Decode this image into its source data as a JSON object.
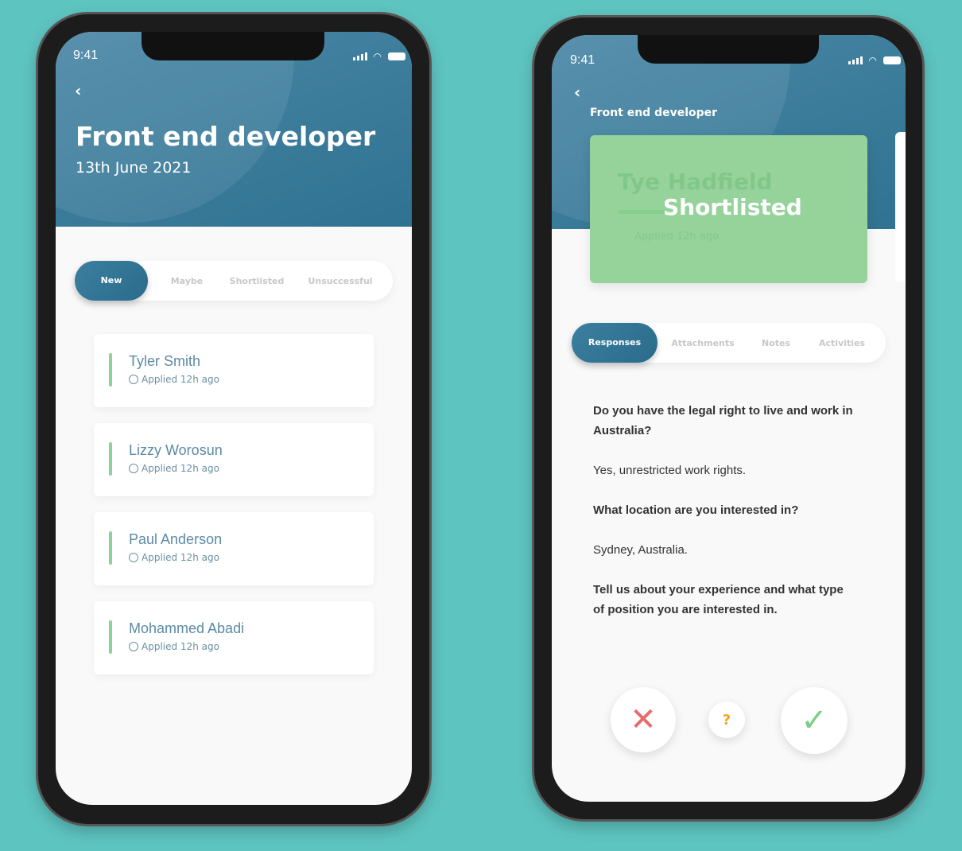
{
  "status_bar": {
    "time": "9:41"
  },
  "list_screen": {
    "title": "Front end developer",
    "date": "13th June 2021",
    "tabs": [
      "New",
      "Maybe",
      "Shortlisted",
      "Unsuccessful"
    ],
    "active_tab": "New",
    "candidates": [
      {
        "name": "Tyler Smith",
        "applied": "Applied 12h ago"
      },
      {
        "name": "Lizzy Worosun",
        "applied": "Applied 12h ago"
      },
      {
        "name": "Paul Anderson",
        "applied": "Applied 12h ago"
      },
      {
        "name": "Mohammed Abadi",
        "applied": "Applied 12h ago"
      }
    ]
  },
  "detail_screen": {
    "title": "Front end developer",
    "candidate": {
      "name": "Tye Hadfield",
      "status": "Shortlisted",
      "applied": "Applied 12h ago"
    },
    "tabs": [
      "Responses",
      "Attachments",
      "Notes",
      "Activities"
    ],
    "active_tab": "Responses",
    "responses": [
      {
        "q": "Do you have the legal right to live and work in Australia?",
        "a": "Yes, unrestricted work rights."
      },
      {
        "q": "What location are you interested in?",
        "a": "Sydney, Australia."
      },
      {
        "q": "Tell us about your experience and what type of position you are interested in."
      }
    ],
    "actions": {
      "reject": "✕",
      "maybe": "?",
      "accept": "✓"
    }
  },
  "colors": {
    "header": "#3a7b9b",
    "accent_green": "#8ed396",
    "reject": "#e96a6a",
    "maybe": "#f5a623",
    "background": "#5ec4c0"
  }
}
